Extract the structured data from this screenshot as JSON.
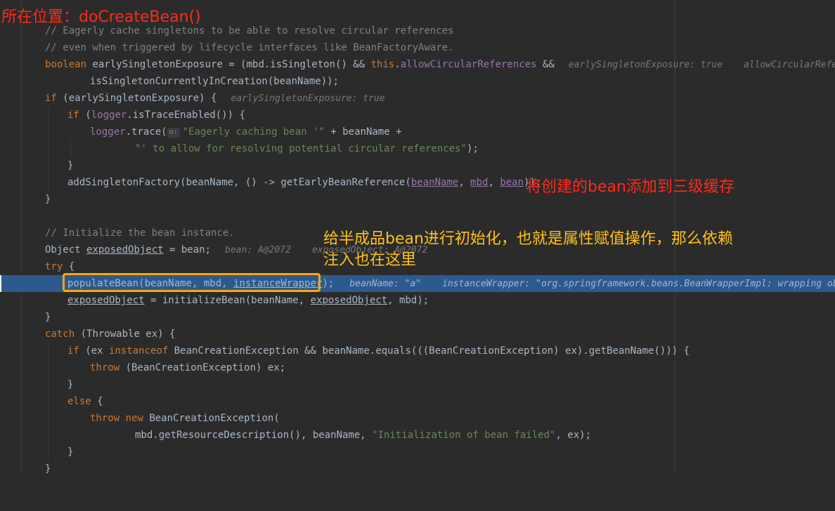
{
  "annotations": {
    "title": "所在位置：doCreateBean()",
    "cache_note": "将创建的bean添加到三级缓存",
    "init_note_line1": "给半成品bean进行初始化，也就是属性赋值操作，那么依赖",
    "init_note_line2": "注入也在这里"
  },
  "code": {
    "l1": "// Eagerly cache singletons to be able to resolve circular references",
    "l2": "// even when triggered by lifecycle interfaces like BeanFactoryAware.",
    "l3_kw": "boolean",
    "l3_a": " earlySingletonExposure = (mbd.isSingleton() && ",
    "l3_this": "this",
    "l3_b": ".",
    "l3_fld": "allowCircularReferences",
    "l3_c": " &&",
    "l3_hint1": "earlySingletonExposure: true",
    "l3_hint2": "allowCircularReferen",
    "l4": "isSingletonCurrentlyInCreation(beanName));",
    "l5_kw": "if",
    "l5_a": " (earlySingletonExposure) {",
    "l5_hint": "earlySingletonExposure: true",
    "l6_kw": "if",
    "l6_a": " (",
    "l6_fld": "logger",
    "l6_b": ".isTraceEnabled()) {",
    "l7_fld": "logger",
    "l7_a": ".trace(",
    "l7_lens": "o:",
    "l7_str": "\"Eagerly caching bean '\"",
    "l7_b": " + beanName +",
    "l8_str": "\"' to allow for resolving potential circular references\"",
    "l8_a": ");",
    "l9": "}",
    "l10_a": "addSingletonFactory(beanName, () -> getEarlyBeanReference(",
    "l10_u1": "beanName",
    "l10_s1": ", ",
    "l10_u2": "mbd",
    "l10_s2": ", ",
    "l10_u3": "bean",
    "l10_b": "));",
    "l11": "}",
    "l13": "// Initialize the bean instance.",
    "l14_a": "Object ",
    "l14_u": "exposedObject",
    "l14_b": " = bean;",
    "l14_hint1": "bean: A@2072",
    "l14_hint2": "exposedObject: A@2072",
    "l15_kw": "try",
    "l15_a": " {",
    "l16_a": "populateBean(beanName, mbd, ",
    "l16_u": "instanceWrapper",
    "l16_b": ");",
    "l16_hint1": "beanName: \"a\"",
    "l16_hint2": "instanceWrapper: \"org.springframework.beans.BeanWrapperImpl: wrapping obj",
    "l17_u1": "exposedObject",
    "l17_a": " = initializeBean(beanName, ",
    "l17_u2": "exposedObject",
    "l17_b": ", mbd);",
    "l18": "}",
    "l19_kw": "catch",
    "l19_a": " (Throwable ex) {",
    "l20_kw": "if",
    "l20_a": " (ex ",
    "l20_kw2": "instanceof",
    "l20_b": " BeanCreationException && beanName.equals(((BeanCreationException) ex).getBeanName())) {",
    "l21_kw": "throw",
    "l21_a": " (BeanCreationException) ex;",
    "l22": "}",
    "l23_kw": "else",
    "l23_a": " {",
    "l24_kw": "throw",
    "l24_kw2": "new",
    "l24_a": " BeanCreationException(",
    "l25_a": "mbd.getResourceDescription(), beanName, ",
    "l25_str": "\"Initialization of bean failed\"",
    "l25_b": ", ex);",
    "l26": "}",
    "l27": "}"
  }
}
